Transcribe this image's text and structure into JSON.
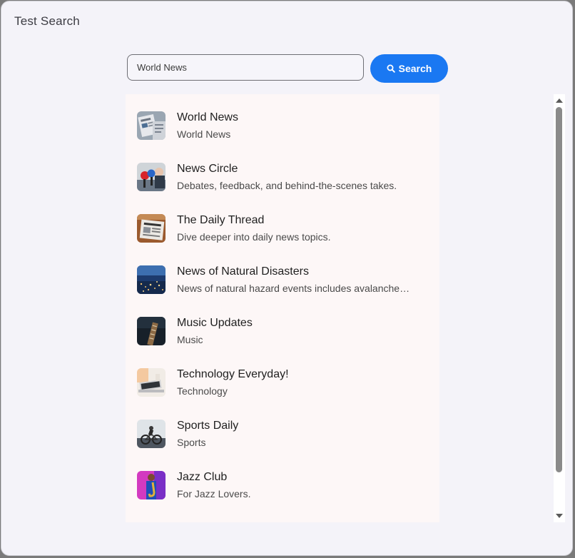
{
  "dialog": {
    "title": "Test Search"
  },
  "search": {
    "value": "World News",
    "button_label": "Search",
    "button_icon": "search-icon",
    "accent_color": "#1a78f2"
  },
  "results": [
    {
      "title": "World News",
      "subtitle": "World News",
      "thumbnail": "newspaper-photo"
    },
    {
      "title": "News Circle",
      "subtitle": "Debates, feedback, and behind-the-scenes takes.",
      "thumbnail": "microphones-photo"
    },
    {
      "title": "The Daily Thread",
      "subtitle": "Dive deeper into daily news topics.",
      "thumbnail": "newspaper-desk-photo"
    },
    {
      "title": "News of Natural Disasters",
      "subtitle": "News of natural hazard events includes avalanches, earthquakes, floods and more",
      "thumbnail": "city-night-photo"
    },
    {
      "title": "Music Updates",
      "subtitle": "Music",
      "thumbnail": "guitar-photo"
    },
    {
      "title": "Technology Everyday!",
      "subtitle": "Technology",
      "thumbnail": "laptop-photo"
    },
    {
      "title": "Sports Daily",
      "subtitle": "Sports",
      "thumbnail": "cyclist-photo"
    },
    {
      "title": "Jazz Club",
      "subtitle": "For Jazz Lovers.",
      "thumbnail": "saxophone-photo"
    }
  ]
}
